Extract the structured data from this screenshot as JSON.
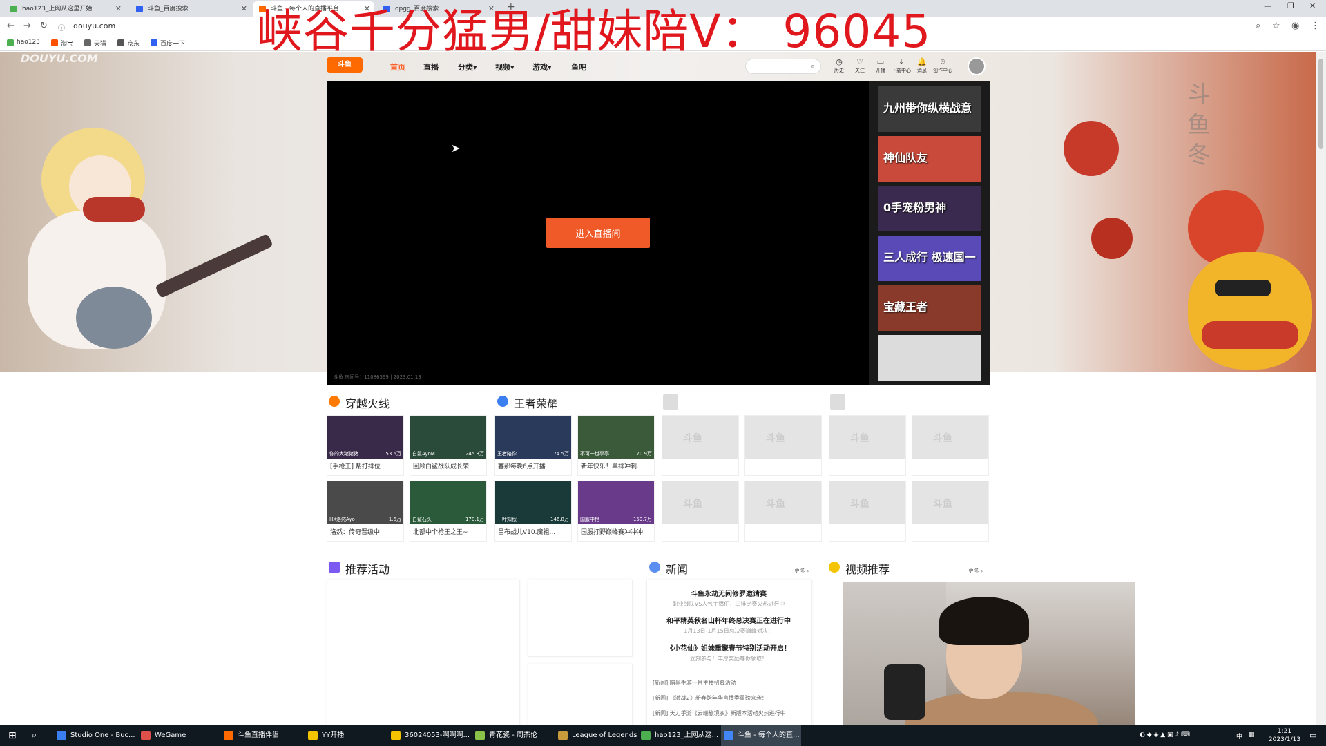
{
  "browser": {
    "tabs": [
      {
        "title": "hao123_上网从这里开始",
        "active": false,
        "favicon_color": "#4caf50"
      },
      {
        "title": "斗鱼_百度搜索",
        "active": false,
        "favicon_color": "#3061f2"
      },
      {
        "title": "斗鱼 - 每个人的直播平台",
        "active": true,
        "favicon_color": "#ff6a00"
      },
      {
        "title": "opgg_百度搜索",
        "active": false,
        "favicon_color": "#3061f2"
      }
    ],
    "new_tab": "+",
    "url": "douyu.com",
    "bookmarks": [
      {
        "label": "hao123",
        "color": "#4caf50"
      },
      {
        "label": "淘宝",
        "color": "#ff5000"
      },
      {
        "label": "天猫",
        "color": "#666666"
      },
      {
        "label": "京东",
        "color": "#555555"
      },
      {
        "label": "百度一下",
        "color": "#3061f2"
      }
    ]
  },
  "overlay_text": "峡谷千分猛男/甜妹陪V： 96045",
  "site": {
    "watermark": "DOUYU.COM",
    "side_title": "斗鱼冬",
    "logo": "斗鱼",
    "nav": [
      {
        "label": "首页",
        "active": true
      },
      {
        "label": "直播",
        "active": false
      },
      {
        "label": "分类▾",
        "active": false
      },
      {
        "label": "视频▾",
        "active": false
      },
      {
        "label": "游戏▾",
        "active": false
      },
      {
        "label": "鱼吧",
        "active": false
      }
    ],
    "search_placeholder": "",
    "header_icons": [
      {
        "label": "历史",
        "icon": "history-icon",
        "glyph": "◷"
      },
      {
        "label": "关注",
        "icon": "heart-icon",
        "glyph": "♡"
      },
      {
        "label": "开播",
        "icon": "broadcast-icon",
        "glyph": "▭"
      },
      {
        "label": "下载中心",
        "icon": "download-icon",
        "glyph": "⤓"
      },
      {
        "label": "消息",
        "icon": "bell-icon",
        "glyph": "🔔"
      },
      {
        "label": "创作中心",
        "icon": "location-icon",
        "glyph": "⌾"
      }
    ]
  },
  "player": {
    "enter_button": "进入直播间",
    "room_info": "斗鱼 房间号：11086399 | 2023.01.13",
    "recommendations": [
      {
        "text": "九州带你纵横战意",
        "color": "#3a3a3a"
      },
      {
        "text": "神仙队友",
        "color": "#c94a3a"
      },
      {
        "text": "0手宠粉男神",
        "color": "#3b2a4f"
      },
      {
        "text": "三人成行 极速国一",
        "color": "#5a4ab8"
      },
      {
        "text": "宝藏王者",
        "color": "#8a3a2a"
      },
      {
        "text": "",
        "color": "#dcdcdc"
      }
    ]
  },
  "sections": {
    "cf": {
      "title": "穿越火线",
      "icon_color": "#ff7a00",
      "cards": [
        {
          "streamer": "你的大猪猪猪",
          "hot": "53.6万",
          "title": "[手枪王] 帮打排位",
          "color": "#3a2a4a"
        },
        {
          "streamer": "白鲨AyoM",
          "hot": "245.8万",
          "title": "回顾白鲨战队成长荣...",
          "color": "#2a4a3a"
        },
        {
          "streamer": "HX洛然Ayo",
          "hot": "1.6万",
          "title": "洛然：传奇晋级中",
          "color": "#4a4a4a"
        },
        {
          "streamer": "白鲨石头",
          "hot": "170.1万",
          "title": "北部中个枪王之王~",
          "color": "#2a5a3a"
        }
      ]
    },
    "wzry": {
      "title": "王者荣耀",
      "icon_color": "#3a7ef0",
      "cards": [
        {
          "streamer": "王者陪你",
          "hot": "174.5万",
          "title": "塞那每晚6点开播",
          "color": "#2a3a5a"
        },
        {
          "streamer": "不可一世亭亭",
          "hot": "170.9万",
          "title": "新年快乐！单排冲刺...",
          "color": "#3a5a3a"
        },
        {
          "streamer": "一叶知秋",
          "hot": "146.8万",
          "title": "吕布战儿V10.魔祖...",
          "color": "#1a3a3a"
        },
        {
          "streamer": "国服中枪",
          "hot": "159.7万",
          "title": "国服打野巅峰赛冲冲冲",
          "color": "#6a3a8a"
        }
      ]
    },
    "placeholder_label": "斗鱼"
  },
  "lower": {
    "activities_title": "推荐活动",
    "news_title": "新闻",
    "video_title": "视频推荐",
    "more": "更多 ›",
    "news_items": [
      {
        "title": "斗鱼永劫无间修罗邀请赛",
        "sub": "职业战队VS人气主播们，三排比赛火热进行中"
      },
      {
        "title": "和平精英秋名山杯年终总决赛正在进行中",
        "sub": "1月13日-1月15日总决赛巅峰对决！"
      },
      {
        "title": "《小花仙》姐妹重聚春节特别活动开启！",
        "sub": "立刻参与！丰厚奖励等你领取！"
      }
    ],
    "news_lines": [
      "[新闻] 暗黑手游一月主播招募活动",
      "[新闻] 《激战2》新春跨年华直播季重磅来袭！",
      "[新闻] 天刀手游《云端旅境衣》新版本活动火热进行中"
    ]
  },
  "taskbar": {
    "items": [
      {
        "label": "Studio One - Buc...",
        "color": "#3a7ef0",
        "active": false
      },
      {
        "label": "WeGame",
        "color": "#e0504a",
        "active": false
      },
      {
        "label": "斗鱼直播伴侣",
        "color": "#ff6a00",
        "active": false
      },
      {
        "label": "YY开播",
        "color": "#f5c400",
        "active": false
      },
      {
        "label": "36024053-啊啊啊...",
        "color": "#f5c400",
        "active": false
      },
      {
        "label": "青花瓷 - 周杰伦",
        "color": "#8bc34a",
        "active": false
      },
      {
        "label": "League of Legends",
        "color": "#c89b3c",
        "active": false
      },
      {
        "label": "hao123_上网从这...",
        "color": "#4caf50",
        "active": false
      },
      {
        "label": "斗鱼 - 每个人的直...",
        "color": "#4285f4",
        "active": true
      }
    ],
    "ime": "中",
    "time": "1:21",
    "date": "2023/1/13"
  }
}
